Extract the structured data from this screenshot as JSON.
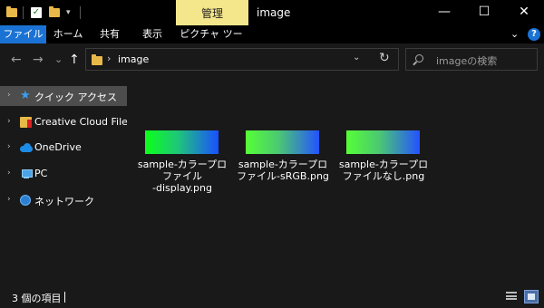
{
  "titlebar": {
    "context_tab": "管理",
    "window_title": "image",
    "qa_dropdown": "▾",
    "minimize": "—",
    "maximize": "☐",
    "close": "✕"
  },
  "ribbon": {
    "tabs": [
      "ファイル",
      "ホーム",
      "共有",
      "表示",
      "ピクチャ ツール"
    ],
    "active_tab_color": "#1a73d4",
    "collapse_icon": "⌄",
    "help_icon": "?"
  },
  "address": {
    "back": "←",
    "forward": "→",
    "recent": "⌄",
    "up": "↑",
    "crumb_separator": "›",
    "crumb": "image",
    "dropdown": "⌄",
    "refresh": "↻",
    "search_placeholder": "imageの検索"
  },
  "navpane": {
    "expander": "›",
    "items": [
      {
        "label": "クイック アクセス",
        "icon": "star-icon",
        "glyph": "★"
      },
      {
        "label": "Creative Cloud Files",
        "icon": "creative-cloud-folder-icon"
      },
      {
        "label": "OneDrive",
        "icon": "onedrive-cloud-icon"
      },
      {
        "label": "PC",
        "icon": "pc-icon"
      },
      {
        "label": "ネットワーク",
        "icon": "network-icon"
      }
    ]
  },
  "files": [
    {
      "name_lines": [
        "sample-カラープロ",
        "ファイル",
        "-display.png"
      ]
    },
    {
      "name_lines": [
        "sample-カラープロ",
        "ファイル-sRGB.png"
      ]
    },
    {
      "name_lines": [
        "sample-カラープロ",
        "ファイルなし.png"
      ]
    }
  ],
  "status": {
    "item_count": "3 個の項目"
  }
}
